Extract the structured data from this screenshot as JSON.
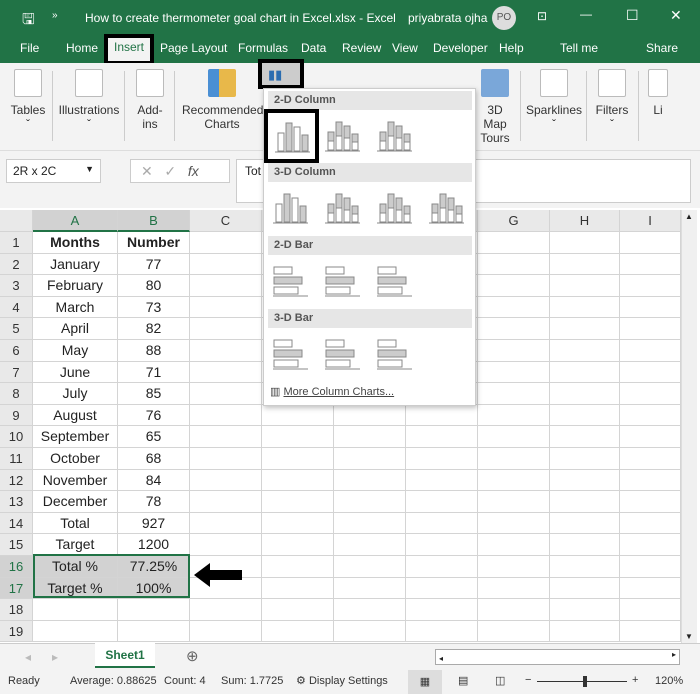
{
  "window": {
    "title": "How to create thermometer goal chart in Excel.xlsx  -  Excel",
    "user": "priyabrata ojha",
    "initials": "PO"
  },
  "tabs": [
    "File",
    "Home",
    "Insert",
    "Page Layout",
    "Formulas",
    "Data",
    "Review",
    "View",
    "Developer",
    "Help",
    "Tell me",
    "Share"
  ],
  "active_tab": "Insert",
  "ribbon": {
    "tables": "Tables",
    "illustrations": "Illustrations",
    "addins": "Add-ins",
    "recommended": "Recommended Charts",
    "map3d": "3D Map",
    "tours": "Tours",
    "sparklines": "Sparklines",
    "filters": "Filters",
    "links": "Li"
  },
  "formula": {
    "name_box": "2R x 2C",
    "content": "Tot"
  },
  "columns": [
    "A",
    "B",
    "C",
    "D",
    "E",
    "F",
    "G",
    "H",
    "I"
  ],
  "rows": [
    [
      "Months",
      "Number"
    ],
    [
      "January",
      "77"
    ],
    [
      "February",
      "80"
    ],
    [
      "March",
      "73"
    ],
    [
      "April",
      "82"
    ],
    [
      "May",
      "88"
    ],
    [
      "June",
      "71"
    ],
    [
      "July",
      "85"
    ],
    [
      "August",
      "76"
    ],
    [
      "September",
      "65"
    ],
    [
      "October",
      "68"
    ],
    [
      "November",
      "84"
    ],
    [
      "December",
      "78"
    ],
    [
      "Total",
      "927"
    ],
    [
      "Target",
      "1200"
    ],
    [
      "Total %",
      "77.25%"
    ],
    [
      "Target %",
      "100%"
    ],
    [
      "",
      ""
    ],
    [
      "",
      ""
    ]
  ],
  "dropdown": {
    "sections": [
      "2-D Column",
      "3-D Column",
      "2-D Bar",
      "3-D Bar"
    ],
    "more": "More Column Charts..."
  },
  "sheets": [
    "Sheet1"
  ],
  "status": {
    "ready": "Ready",
    "average": "Average: 0.88625",
    "count": "Count: 4",
    "sum": "Sum: 1.7725",
    "display": "Display Settings",
    "zoom": "120%"
  },
  "colors": {
    "accent": "#217346",
    "highlight_border": "#000000"
  }
}
